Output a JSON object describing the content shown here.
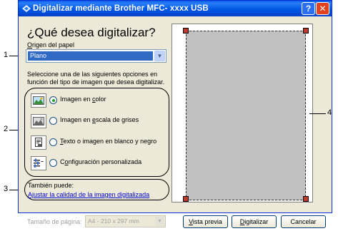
{
  "window": {
    "title": "Digitalizar mediante Brother MFC- xxxx USB",
    "help_label": "?",
    "close_label": "✕"
  },
  "heading": "¿Qué desea digitalizar?",
  "paper_source": {
    "label_prefix": "O",
    "label_rest": "rigen del papel",
    "value": "Plano"
  },
  "instructions": {
    "line1": "Seleccione una de las siguientes opciones en",
    "line2": "función del tipo de imagen que desea digitalizar."
  },
  "options": [
    {
      "pre": "Imagen en ",
      "acc": "c",
      "post": "olor",
      "checked": true,
      "icon": "color-photo-icon"
    },
    {
      "pre": "Imagen en ",
      "acc": "e",
      "post": "scala de grises",
      "checked": false,
      "icon": "grayscale-photo-icon"
    },
    {
      "pre": "",
      "acc": "T",
      "post": "exto o imagen en blanco y negro",
      "checked": false,
      "icon": "text-document-icon"
    },
    {
      "pre": "C",
      "acc": "o",
      "post": "nfiguración personalizada",
      "checked": false,
      "icon": "custom-settings-icon"
    }
  ],
  "also": {
    "label": "También puede:",
    "link": "Ajustar la calidad de la imagen digitalizada"
  },
  "page_size": {
    "label": "Tamaño de página:",
    "value": "A4 - 210 x 297 mm"
  },
  "buttons": {
    "preview": {
      "pre": "",
      "acc": "V",
      "post": "ista previa"
    },
    "scan": {
      "pre": "",
      "acc": "D",
      "post": "igitalizar"
    },
    "cancel": "Cancelar"
  },
  "callouts": [
    "1",
    "2",
    "3",
    "4"
  ],
  "colors": {
    "titlebar": "#0058e6",
    "selection": "#316ac5",
    "link": "#0000cc",
    "handle": "#c0392b"
  }
}
